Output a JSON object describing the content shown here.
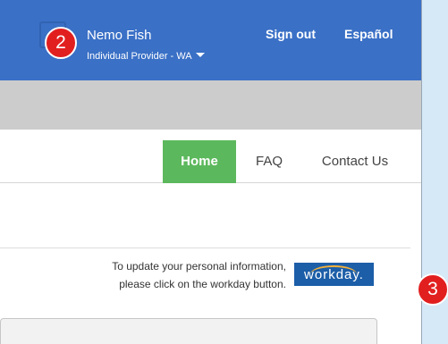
{
  "header": {
    "user_name": "Nemo Fish",
    "user_role": "Individual Provider - WA",
    "sign_out": "Sign out",
    "language": "Español"
  },
  "nav": {
    "home": "Home",
    "faq": "FAQ",
    "contact": "Contact Us",
    "active": "Home"
  },
  "workday": {
    "instruction_line1": "To update your personal information,",
    "instruction_line2": "please click on the workday button.",
    "button_label": "workday."
  },
  "annotations": {
    "badge_2": "2",
    "badge_3": "3"
  },
  "colors": {
    "header_bg": "#3a70c6",
    "active_nav": "#5cb85c",
    "workday_bg": "#1c5ea8",
    "badge": "#e21f1f",
    "page_bg": "#d6e9f7"
  },
  "icons": {
    "user_menu_caret": "caret-down-icon"
  }
}
